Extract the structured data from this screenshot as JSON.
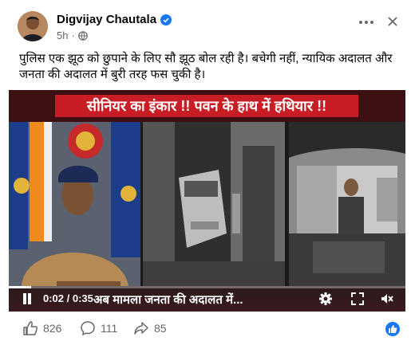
{
  "post": {
    "author": "Digvijay Chautala",
    "time": "5h",
    "separator": "·",
    "caption": "पुलिस एक झूठ को छुपाने के लिए सौ झूठ बोल रही है। बचेगी नहीं, न्यायिक अदालत और जनता की अदालत में बुरी तरह फस चुकी है।"
  },
  "video": {
    "banner_text": "सीनियर का इंकार !! पवन के हाथ में हथियार !!",
    "time": "0:02 / 0:35",
    "ticker": "अब मामला जनता की अदालत में...",
    "progress": 0.057
  },
  "actions": {
    "likes": "826",
    "comments": "111",
    "shares": "85"
  },
  "colors": {
    "verified": "#1877f2",
    "banner_red": "#c81d24",
    "meta_grey": "#65676b"
  },
  "icons": [
    "verified-badge-icon",
    "globe-icon",
    "more-options-icon",
    "close-icon",
    "pause-icon",
    "settings-icon",
    "fullscreen-icon",
    "mute-icon",
    "like-icon",
    "comment-icon",
    "share-icon",
    "facebook-like-icon"
  ]
}
